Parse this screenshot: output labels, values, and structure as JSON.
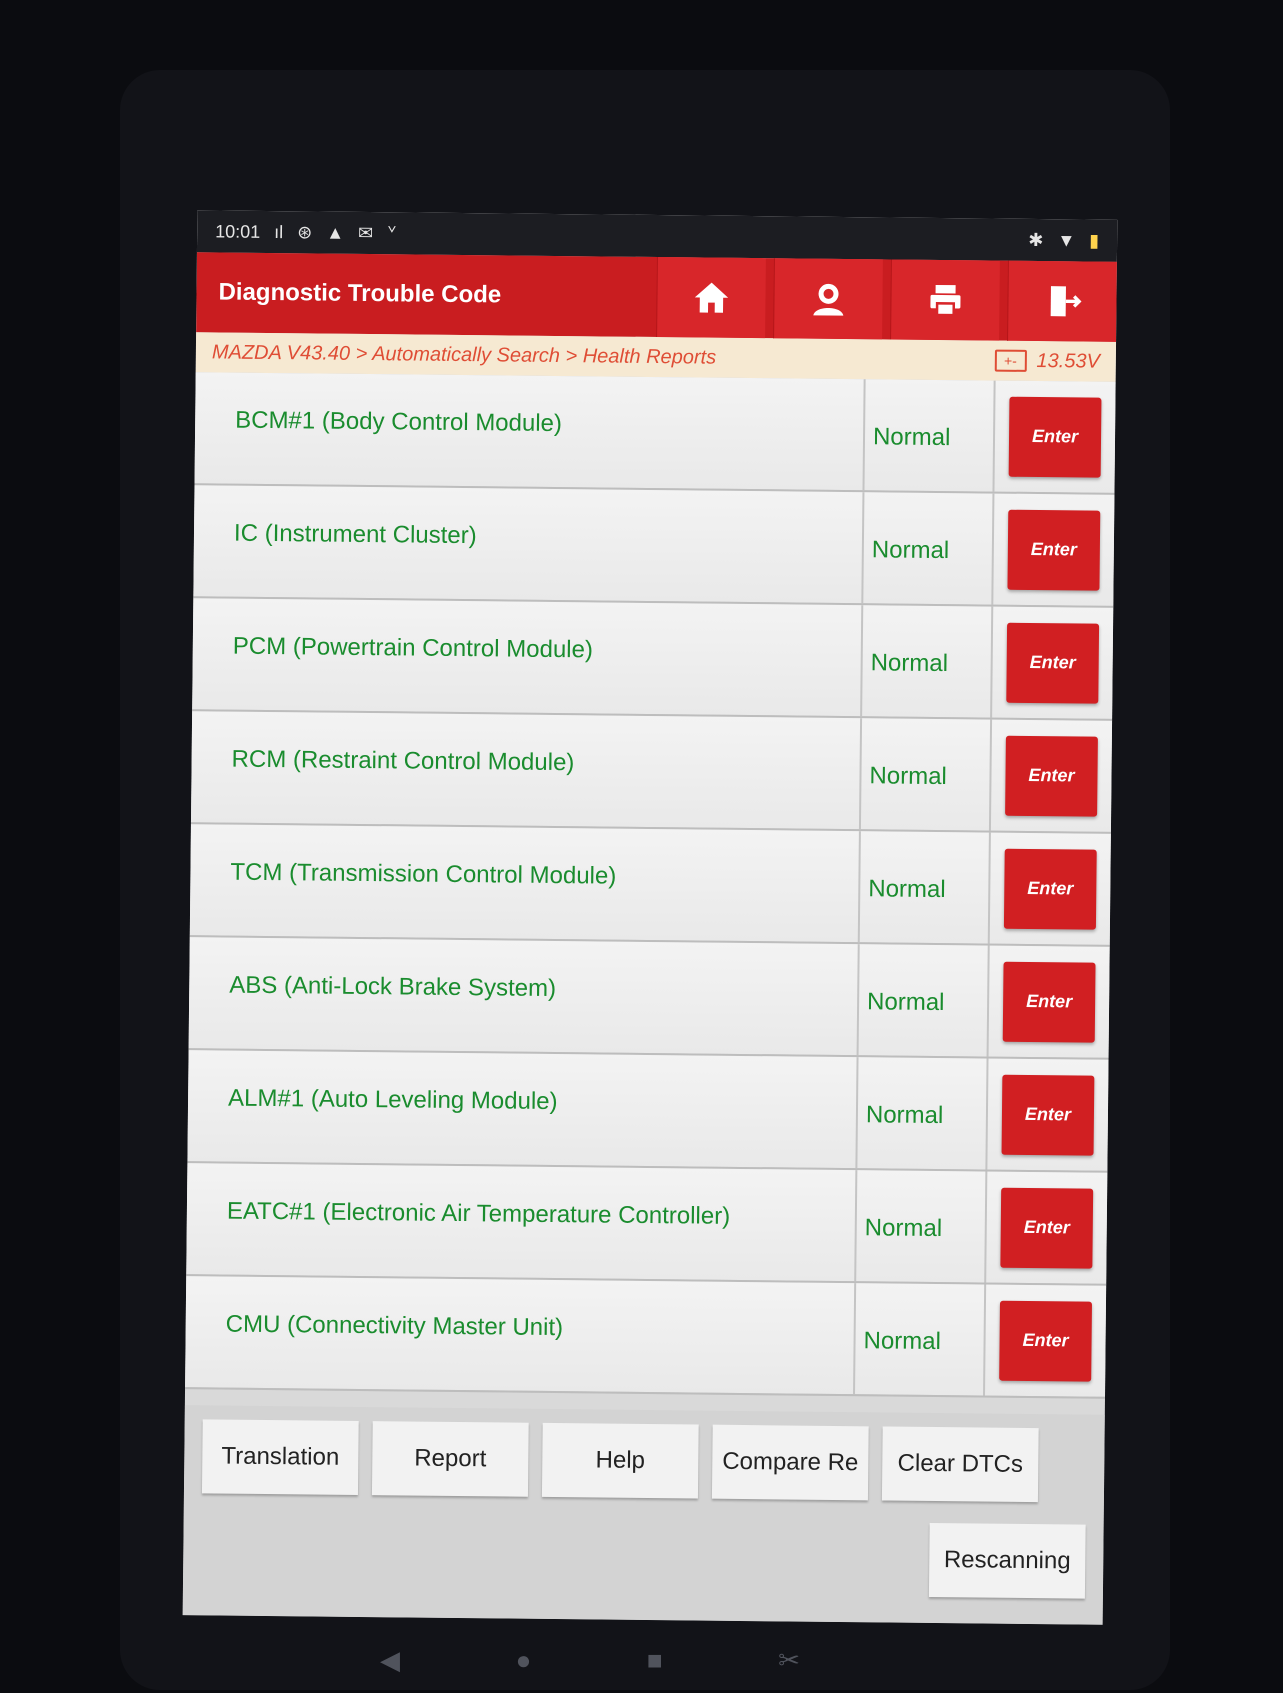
{
  "statusbar": {
    "time": "10:01",
    "left_icons": [
      "signal-icon",
      "settings-icon",
      "warning-icon",
      "mail-icon",
      "usb-icon"
    ],
    "right_icons": [
      "bluetooth-icon",
      "wifi-icon",
      "battery-icon"
    ]
  },
  "titlebar": {
    "title": "Diagnostic Trouble Code",
    "buttons": [
      "home-icon",
      "user-icon",
      "print-icon",
      "exit-icon"
    ]
  },
  "breadcrumb": {
    "text": "MAZDA V43.40 > Automatically Search > Health Reports",
    "voltage": "13.53V"
  },
  "modules": [
    {
      "name": "BCM#1 (Body Control Module)",
      "status": "Normal",
      "action": "Enter"
    },
    {
      "name": "IC (Instrument Cluster)",
      "status": "Normal",
      "action": "Enter"
    },
    {
      "name": "PCM (Powertrain Control Module)",
      "status": "Normal",
      "action": "Enter"
    },
    {
      "name": "RCM (Restraint Control Module)",
      "status": "Normal",
      "action": "Enter"
    },
    {
      "name": "TCM (Transmission Control Module)",
      "status": "Normal",
      "action": "Enter"
    },
    {
      "name": "ABS (Anti-Lock Brake System)",
      "status": "Normal",
      "action": "Enter"
    },
    {
      "name": "ALM#1 (Auto Leveling Module)",
      "status": "Normal",
      "action": "Enter"
    },
    {
      "name": "EATC#1 (Electronic Air Temperature Controller)",
      "status": "Normal",
      "action": "Enter"
    },
    {
      "name": "CMU (Connectivity Master Unit)",
      "status": "Normal",
      "action": "Enter"
    }
  ],
  "bottom": {
    "translation": "Translation",
    "report": "Report",
    "help": "Help",
    "compare": "Compare Re",
    "clear": "Clear DTCs",
    "rescan": "Rescanning"
  },
  "colors": {
    "brand_red": "#c91d20",
    "ok_green": "#1a8c2e",
    "crumb_text": "#df4d35"
  }
}
